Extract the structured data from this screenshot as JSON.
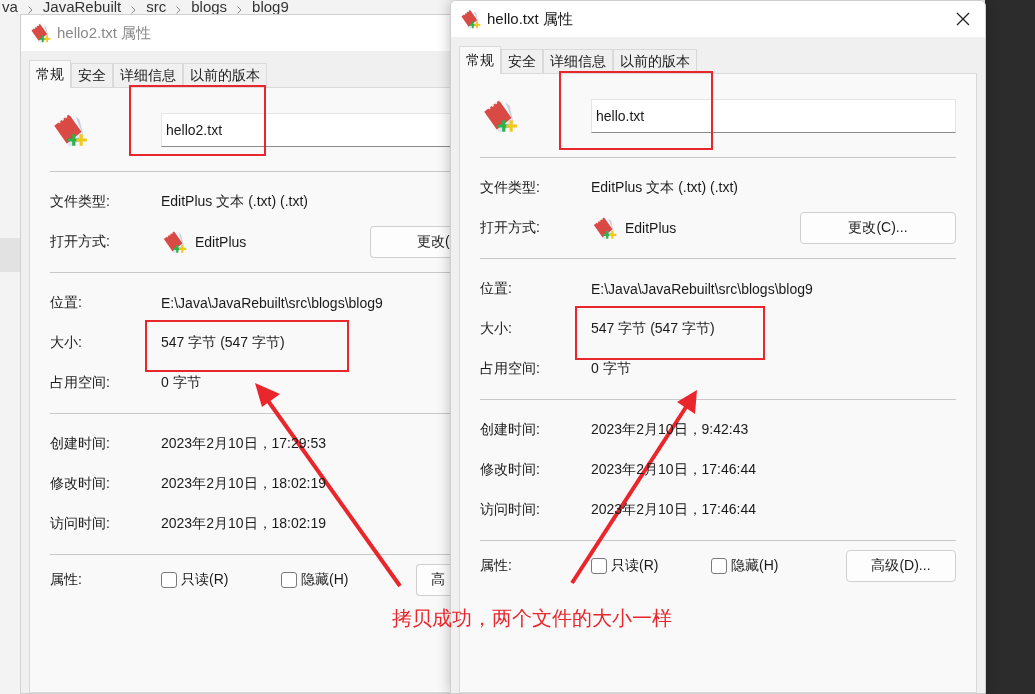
{
  "explorer": {
    "breadcrumb": [
      "va",
      "JavaRebuilt",
      "src",
      "blogs",
      "blog9"
    ]
  },
  "dialogs": [
    {
      "title": "hello2.txt 属性",
      "active": false,
      "tabs": [
        {
          "label": "常规",
          "selected": true
        },
        {
          "label": "安全",
          "selected": false
        },
        {
          "label": "详细信息",
          "selected": false
        },
        {
          "label": "以前的版本",
          "selected": false
        }
      ],
      "file_name": {
        "value": "hello2.txt",
        "highlighted": true
      },
      "sections": [
        [
          {
            "kind": "text",
            "label": "文件类型:",
            "value": "EditPlus 文本 (.txt) (.txt)",
            "highlighted": false
          },
          {
            "kind": "app",
            "label": "打开方式:",
            "value": "EditPlus",
            "button": "更改(",
            "highlighted": false
          }
        ],
        [
          {
            "kind": "text",
            "label": "位置:",
            "value": "E:\\Java\\JavaRebuilt\\src\\blogs\\blog9",
            "highlighted": false
          },
          {
            "kind": "text",
            "label": "大小:",
            "value": "547 字节 (547 字节)",
            "highlighted": true
          },
          {
            "kind": "text",
            "label": "占用空间:",
            "value": "0 字节",
            "highlighted": false
          }
        ],
        [
          {
            "kind": "text",
            "label": "创建时间:",
            "value": "2023年2月10日，17:29:53",
            "highlighted": false
          },
          {
            "kind": "text",
            "label": "修改时间:",
            "value": "2023年2月10日，18:02:19",
            "highlighted": false
          },
          {
            "kind": "text",
            "label": "访问时间:",
            "value": "2023年2月10日，18:02:19",
            "highlighted": false
          }
        ]
      ],
      "attributes": {
        "label": "属性:",
        "checkboxes": [
          {
            "label": "只读(R)",
            "checked": false
          },
          {
            "label": "隐藏(H)",
            "checked": false
          }
        ],
        "button": "高"
      }
    },
    {
      "title": "hello.txt 属性",
      "active": true,
      "tabs": [
        {
          "label": "常规",
          "selected": true
        },
        {
          "label": "安全",
          "selected": false
        },
        {
          "label": "详细信息",
          "selected": false
        },
        {
          "label": "以前的版本",
          "selected": false
        }
      ],
      "file_name": {
        "value": "hello.txt",
        "highlighted": true
      },
      "sections": [
        [
          {
            "kind": "text",
            "label": "文件类型:",
            "value": "EditPlus 文本 (.txt) (.txt)",
            "highlighted": false
          },
          {
            "kind": "app",
            "label": "打开方式:",
            "value": "EditPlus",
            "button": "更改(C)...",
            "highlighted": false
          }
        ],
        [
          {
            "kind": "text",
            "label": "位置:",
            "value": "E:\\Java\\JavaRebuilt\\src\\blogs\\blog9",
            "highlighted": false
          },
          {
            "kind": "text",
            "label": "大小:",
            "value": "547 字节 (547 字节)",
            "highlighted": true
          },
          {
            "kind": "text",
            "label": "占用空间:",
            "value": "0 字节",
            "highlighted": false
          }
        ],
        [
          {
            "kind": "text",
            "label": "创建时间:",
            "value": "2023年2月10日，9:42:43",
            "highlighted": false
          },
          {
            "kind": "text",
            "label": "修改时间:",
            "value": "2023年2月10日，17:46:44",
            "highlighted": false
          },
          {
            "kind": "text",
            "label": "访问时间:",
            "value": "2023年2月10日，17:46:44",
            "highlighted": false
          }
        ]
      ],
      "attributes": {
        "label": "属性:",
        "checkboxes": [
          {
            "label": "只读(R)",
            "checked": false
          },
          {
            "label": "隐藏(H)",
            "checked": false
          }
        ],
        "button": "高级(D)..."
      }
    }
  ],
  "annotation": {
    "caption": "拷贝成功，两个文件的大小一样"
  }
}
